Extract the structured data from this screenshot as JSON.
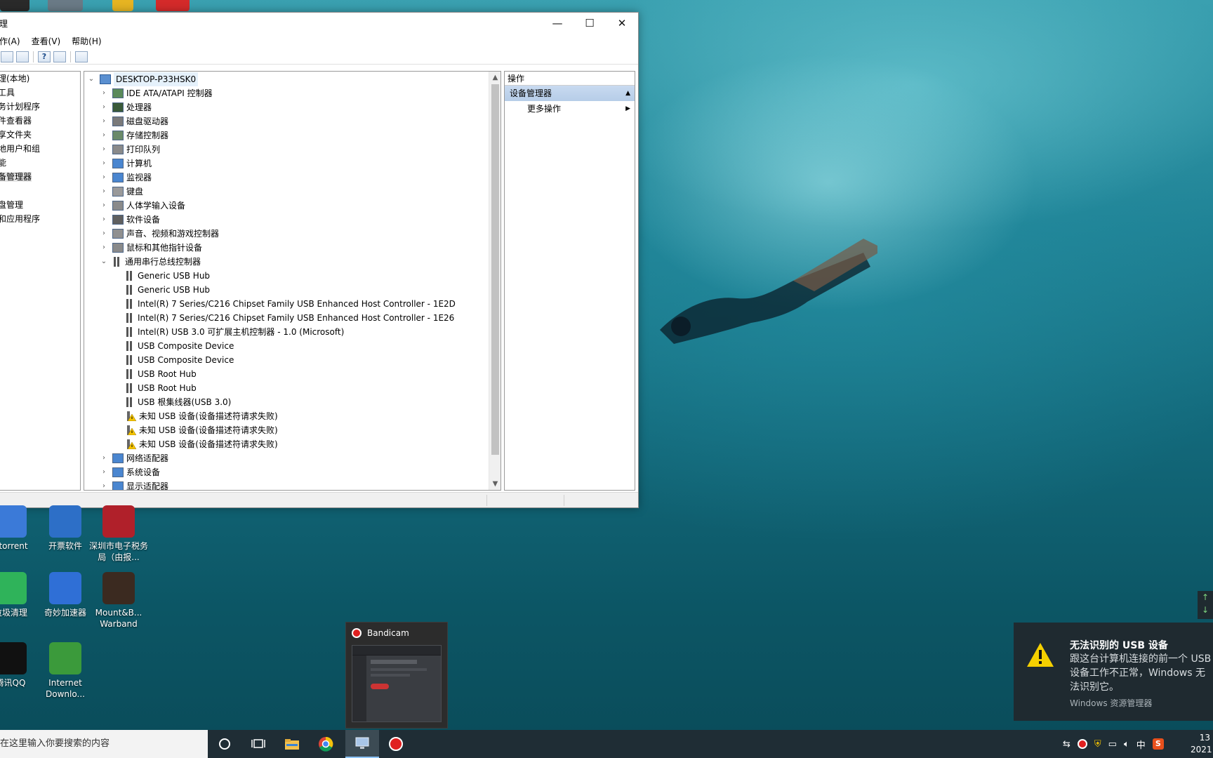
{
  "window": {
    "title": "理",
    "controls": {
      "minimize": "—",
      "maximize": "☐",
      "close": "✕"
    }
  },
  "menu": [
    "作(A)",
    "查看(V)",
    "帮助(H)"
  ],
  "left_tree": [
    {
      "label": "理(本地)",
      "selected": false
    },
    {
      "label": "工具",
      "selected": false
    },
    {
      "label": "务计划程序",
      "selected": false
    },
    {
      "label": "件查看器",
      "selected": false
    },
    {
      "label": "享文件夹",
      "selected": false
    },
    {
      "label": "地用户和组",
      "selected": false
    },
    {
      "label": "能",
      "selected": false
    },
    {
      "label": "备管理器",
      "selected": true
    },
    {
      "label": "",
      "selected": false
    },
    {
      "label": "盘管理",
      "selected": false
    },
    {
      "label": "和应用程序",
      "selected": false
    }
  ],
  "device_tree": {
    "root": "DESKTOP-P33HSK0",
    "categories_top": [
      "IDE ATA/ATAPI 控制器",
      "处理器",
      "磁盘驱动器",
      "存储控制器",
      "打印队列",
      "计算机",
      "监视器",
      "键盘",
      "人体学输入设备",
      "软件设备",
      "声音、视频和游戏控制器",
      "鼠标和其他指针设备"
    ],
    "usb_category": "通用串行总线控制器",
    "usb_devices": [
      {
        "label": "Generic USB Hub",
        "warning": false
      },
      {
        "label": "Generic USB Hub",
        "warning": false
      },
      {
        "label": "Intel(R) 7 Series/C216 Chipset Family USB Enhanced Host Controller - 1E2D",
        "warning": false
      },
      {
        "label": "Intel(R) 7 Series/C216 Chipset Family USB Enhanced Host Controller - 1E26",
        "warning": false
      },
      {
        "label": "Intel(R) USB 3.0 可扩展主机控制器 - 1.0 (Microsoft)",
        "warning": false
      },
      {
        "label": "USB Composite Device",
        "warning": false
      },
      {
        "label": "USB Composite Device",
        "warning": false
      },
      {
        "label": "USB Root Hub",
        "warning": false
      },
      {
        "label": "USB Root Hub",
        "warning": false
      },
      {
        "label": "USB 根集线器(USB 3.0)",
        "warning": false
      },
      {
        "label": "未知 USB 设备(设备描述符请求失败)",
        "warning": true
      },
      {
        "label": "未知 USB 设备(设备描述符请求失败)",
        "warning": true
      },
      {
        "label": "未知 USB 设备(设备描述符请求失败)",
        "warning": true
      }
    ],
    "categories_bottom": [
      "网络适配器",
      "系统设备",
      "显示适配器"
    ]
  },
  "actions": {
    "header": "操作",
    "section": "设备管理器",
    "more": "更多操作"
  },
  "desktop_icons": [
    {
      "name": "qbittorrent",
      "label": "ittorrent",
      "color": "#3b7ad8"
    },
    {
      "name": "kaipiao",
      "label": "开票软件",
      "color": "#2d6fc7"
    },
    {
      "name": "shenzhen-tax",
      "label": "深圳市电子税务局（由报...",
      "color": "#b0202a"
    },
    {
      "name": "cleaner",
      "label": "垃圾清理",
      "color": "#2fb35a"
    },
    {
      "name": "qimiao",
      "label": "奇妙加速器",
      "color": "#2f6fd6"
    },
    {
      "name": "mount-blade",
      "label": "Mount&B... Warband",
      "color": "#3b2a20"
    },
    {
      "name": "tencent-qq",
      "label": "腾讯QQ",
      "color": "#111111"
    },
    {
      "name": "idm",
      "label": "Internet Downlo...",
      "color": "#3b9a3b"
    }
  ],
  "bandicam": {
    "title": "Bandicam"
  },
  "toast": {
    "title": "无法识别的 USB 设备",
    "body": "跟这台计算机连接的前一个 USB 设备工作不正常，Windows 无法识别它。",
    "source": "Windows 资源管理器"
  },
  "taskbar": {
    "search_placeholder": "在这里输入你要搜索的内容",
    "ime": "中",
    "time": "13",
    "date": "2021"
  }
}
